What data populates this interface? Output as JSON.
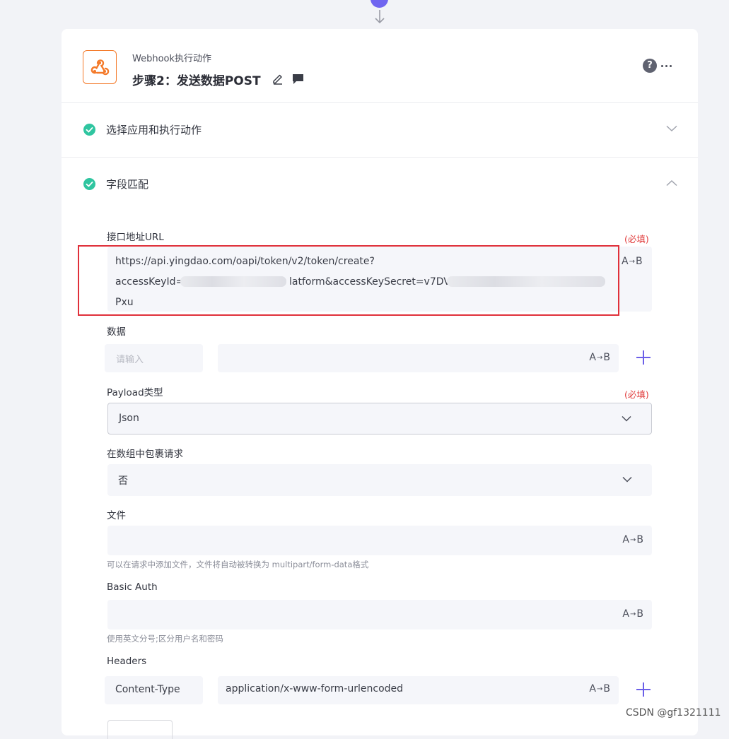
{
  "header": {
    "action_type": "Webhook执行动作",
    "step_title": "步骤2：发送数据POST",
    "help_label": "?"
  },
  "sections": [
    {
      "title": "选择应用和执行动作",
      "state": "collapsed"
    },
    {
      "title": "字段匹配",
      "state": "expanded"
    }
  ],
  "ab_label": {
    "left": "A",
    "right": "B"
  },
  "required_label": "(必填)",
  "fields": {
    "url": {
      "label": "接口地址URL",
      "line1": "https://api.yingdao.com/oapi/token/v2/token/create?",
      "line2_start": "accessKeyId=N",
      "line2_mid": "latform&accessKeySecret=v7DV",
      "line3": "Pxu"
    },
    "data": {
      "label": "数据",
      "key_placeholder": "请输入",
      "value": ""
    },
    "payload_type": {
      "label": "Payload类型",
      "value": "Json"
    },
    "wrap_in_array": {
      "label": "在数组中包裹请求",
      "value": "否"
    },
    "file": {
      "label": "文件",
      "value": "",
      "hint": "可以在请求中添加文件，文件将自动被转换为 multipart/form-data格式"
    },
    "basic_auth": {
      "label": "Basic Auth",
      "value": "",
      "hint": "使用英文分号;区分用户名和密码"
    },
    "headers": {
      "label": "Headers",
      "key": "Content-Type",
      "value": "application/x-www-form-urlencoded"
    }
  },
  "watermark": "CSDN @gf1321111",
  "colors": {
    "accent": "#6b5fe8",
    "success": "#2fc5a0",
    "required": "#e03b3b",
    "highlight": "#e0303a",
    "logo": "#f47a2a"
  }
}
